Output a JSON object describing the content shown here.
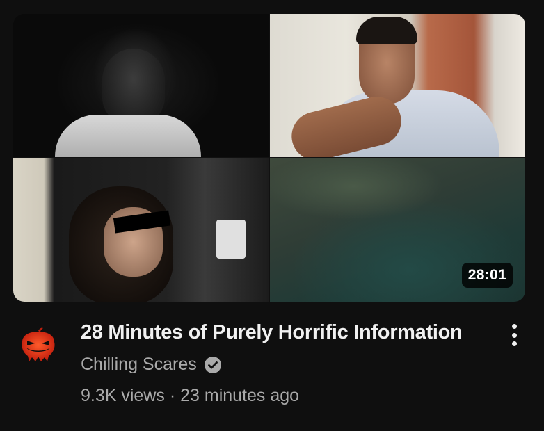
{
  "video": {
    "duration": "28:01",
    "title": "28 Minutes of Purely Horrific Information",
    "channel": "Chilling Scares",
    "views": "9.3K views",
    "separator": " · ",
    "age": "23 minutes ago"
  },
  "icons": {
    "avatar": "pumpkin-logo-icon",
    "verified": "verified-check-icon",
    "menu": "more-vert-icon"
  },
  "colors": {
    "background": "#0f0f0f",
    "title_text": "#f1f1f1",
    "secondary_text": "#aaaaaa",
    "avatar_accent": "#e8381c"
  }
}
